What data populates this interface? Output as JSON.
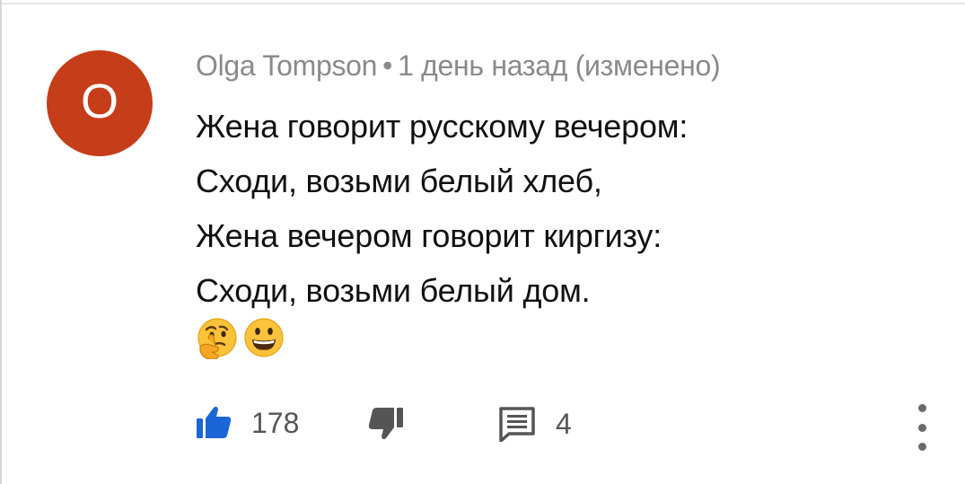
{
  "comment": {
    "author": "Olga Tompson",
    "separator": "•",
    "timestamp": "1 день назад",
    "edited": "(изменено)",
    "avatar_letter": "O",
    "avatar_color": "#c53d19",
    "lines": [
      "Жена говорит русскому вечером:",
      "Сходи, возьми белый хлеб,",
      "Жена вечером говорит киргизу:",
      "Сходи, возьми белый дом."
    ],
    "emojis": [
      "thinking-face-emoji",
      "grinning-face-emoji"
    ]
  },
  "actions": {
    "like_count": "178",
    "reply_count": "4",
    "like_color": "#1a66d8",
    "icon_color": "#555555"
  }
}
